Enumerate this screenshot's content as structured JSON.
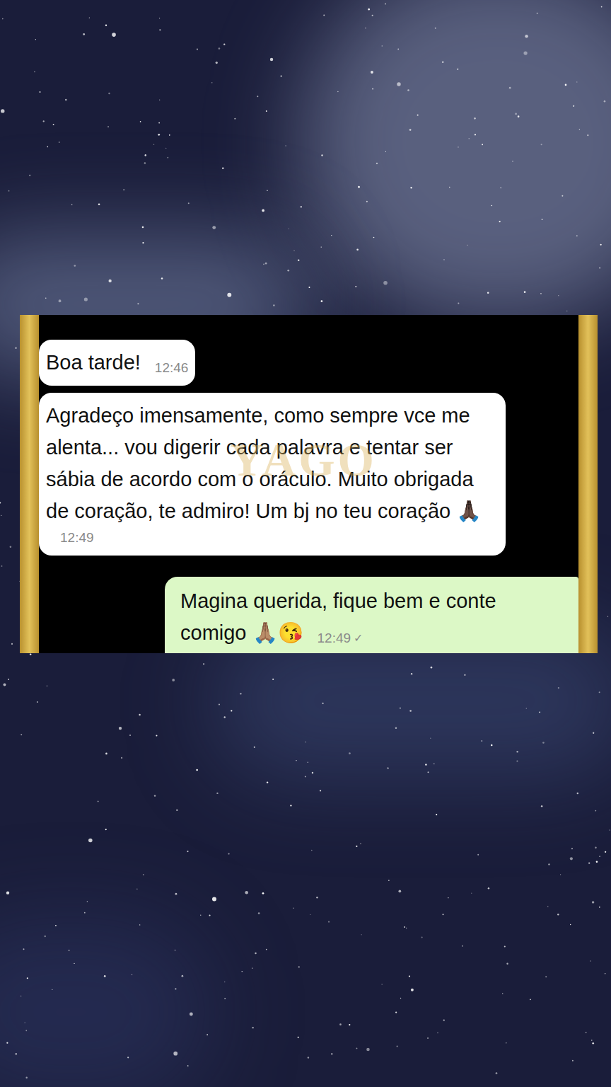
{
  "watermark": "YAGO",
  "chat": {
    "messages": [
      {
        "kind": "incoming",
        "text": "Boa tarde!",
        "time": "12:46",
        "status_icon": ""
      },
      {
        "kind": "incoming",
        "text": "Agradeço imensamente, como sempre vce me alenta... vou digerir cada palavra e tentar ser sábia de acordo com o oráculo. Muito obrigada de coração, te admiro! Um bj no teu coração 🙏🏿",
        "time": "12:49",
        "status_icon": ""
      },
      {
        "kind": "outgoing",
        "text": "Magina querida, fique bem e conte comigo 🙏🏽😘",
        "time": "12:49",
        "status_icon": "✓"
      }
    ]
  }
}
